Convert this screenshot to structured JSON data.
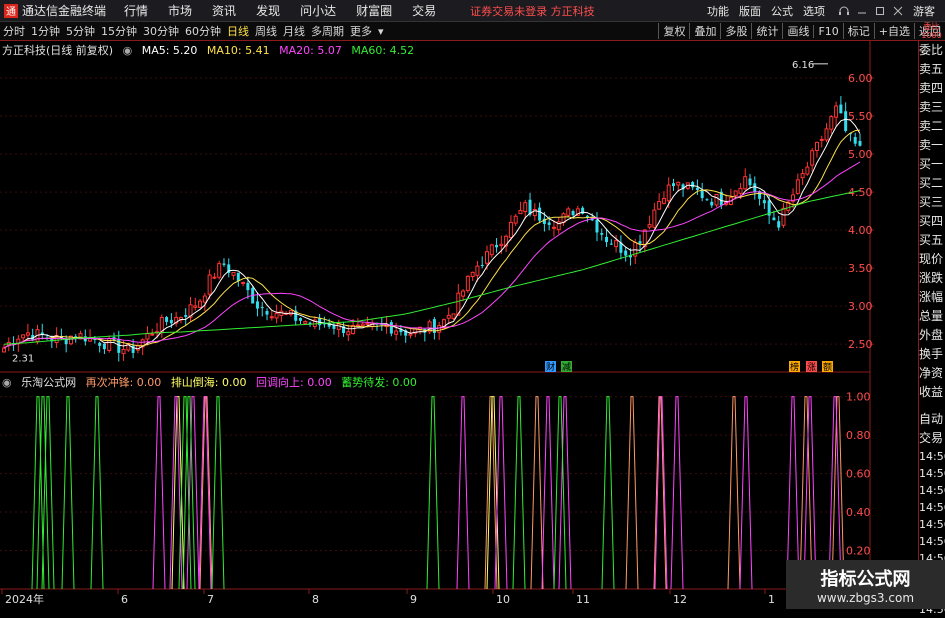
{
  "menubar": {
    "logo_char": "通",
    "app_title": "通达信金融终端",
    "items": [
      "行情",
      "市场",
      "资讯",
      "发现",
      "问小达",
      "财富圈",
      "交易"
    ],
    "notice": "证券交易未登录 方正科技",
    "right_items": [
      "功能",
      "版面",
      "公式",
      "选项"
    ],
    "user": "游客"
  },
  "periods": {
    "items": [
      "分时",
      "1分钟",
      "5分钟",
      "15分钟",
      "30分钟",
      "60分钟",
      "日线",
      "周线",
      "月线",
      "多周期",
      "更多"
    ],
    "active": "日线",
    "tools": [
      "复权",
      "叠加",
      "多股",
      "统计",
      "画线",
      "F10",
      "标记",
      "+自选",
      "返回"
    ]
  },
  "corner": "委比 1000",
  "chart_title": {
    "name": "方正科技(日线 前复权)",
    "ma": [
      {
        "label": "MA5: 5.20",
        "color": "#ffffff"
      },
      {
        "label": "MA10: 5.41",
        "color": "#ffe14a"
      },
      {
        "label": "MA20: 5.07",
        "color": "#ff46ff"
      },
      {
        "label": "MA60: 4.52",
        "color": "#33ee33"
      }
    ]
  },
  "indicator_title": {
    "name": "乐淘公式网",
    "values": [
      {
        "label": "再次冲锋: 0.00",
        "color": "#ff9966"
      },
      {
        "label": "排山倒海: 0.00",
        "color": "#ffff66"
      },
      {
        "label": "回调向上: 0.00",
        "color": "#ff46ff"
      },
      {
        "label": "蓄势待发: 0.00",
        "color": "#33ee33"
      }
    ]
  },
  "annotations": {
    "high_label": "6.16",
    "low_label": "2.31",
    "badges": [
      {
        "text": "财",
        "bg": "#3399ff"
      },
      {
        "text": "减",
        "bg": "#33aa33"
      },
      {
        "text": "榜",
        "bg": "#ffaa00"
      },
      {
        "text": "涨",
        "bg": "#ff4d4d"
      },
      {
        "text": "额",
        "bg": "#ffaa00"
      }
    ]
  },
  "order_book": [
    "委比",
    "卖五",
    "卖四",
    "卖三",
    "卖二",
    "卖一",
    "买一",
    "买二",
    "买三",
    "买四",
    "买五",
    "现价",
    "涨跌",
    "涨幅",
    "总量",
    "外盘",
    "换手",
    "净资",
    "收益"
  ],
  "side_tabs": [
    "自动",
    "交易"
  ],
  "trade_times": [
    "14:56",
    "14:56",
    "14:56",
    "14:56",
    "14:56",
    "14:56",
    "14:56",
    "14:56",
    "14:56",
    "14:56"
  ],
  "watermark": {
    "line1": "指标公式网",
    "line2": "www.zbgs3.com"
  },
  "chart_data": [
    {
      "type": "candlestick",
      "title": "方正科技(日线 前复权)",
      "y_ticks": [
        2.5,
        3.0,
        3.5,
        4.0,
        4.5,
        5.0,
        5.5,
        6.0
      ],
      "ylim": [
        2.2,
        6.25
      ],
      "x_ticks": [
        "2024年",
        "6",
        "7",
        "8",
        "9",
        "10",
        "11",
        "12",
        "1"
      ],
      "high": 6.16,
      "low": 2.31,
      "series": [
        {
          "name": "MA5",
          "value": 5.2
        },
        {
          "name": "MA10",
          "value": 5.41
        },
        {
          "name": "MA20",
          "value": 5.07
        },
        {
          "name": "MA60",
          "value": 4.52
        }
      ],
      "close_path": [
        2.45,
        2.6,
        2.65,
        2.62,
        2.58,
        2.55,
        2.62,
        2.6,
        2.55,
        2.5,
        2.45,
        2.42,
        2.55,
        2.7,
        2.8,
        2.85,
        2.95,
        3.1,
        3.4,
        3.55,
        3.4,
        3.2,
        3.0,
        2.95,
        2.9,
        2.85,
        2.8,
        2.75,
        2.78,
        2.72,
        2.7,
        2.68,
        2.72,
        2.75,
        2.7,
        2.65,
        2.68,
        2.72,
        2.8,
        3.0,
        3.3,
        3.55,
        3.7,
        3.9,
        4.1,
        4.3,
        4.2,
        4.15,
        4.1,
        4.25,
        4.3,
        4.1,
        3.9,
        3.8,
        3.7,
        3.9,
        4.2,
        4.5,
        4.6,
        4.55,
        4.5,
        4.4,
        4.4,
        4.5,
        4.7,
        4.5,
        4.2,
        4.1,
        4.4,
        4.7,
        5.0,
        5.3,
        5.6,
        5.2,
        5.05
      ],
      "ma60_path": [
        2.5,
        2.52,
        2.55,
        2.58,
        2.6,
        2.62,
        2.65,
        2.66,
        2.68,
        2.7,
        2.72,
        2.74,
        2.76,
        2.78,
        2.8,
        2.85,
        2.9,
        2.98,
        3.06,
        3.15,
        3.24,
        3.32,
        3.4,
        3.48,
        3.58,
        3.68,
        3.78,
        3.88,
        3.98,
        4.08,
        4.18,
        4.28,
        4.38,
        4.45,
        4.52
      ]
    },
    {
      "type": "line",
      "title": "乐淘公式网",
      "y_ticks": [
        0.2,
        0.4,
        0.6,
        0.8,
        1.0
      ],
      "ylim": [
        0,
        1.05
      ],
      "series": [
        {
          "name": "再次冲锋",
          "color": "#ff9966",
          "pulses": [
            206,
            491,
            537,
            632,
            660,
            734,
            806,
            838
          ]
        },
        {
          "name": "排山倒海",
          "color": "#ffff66",
          "pulses": [
            178,
            493
          ]
        },
        {
          "name": "回调向上",
          "color": "#ff46ff",
          "pulses": [
            159,
            176,
            193,
            205,
            463,
            501,
            548,
            565,
            661,
            677,
            746,
            793,
            810,
            835
          ]
        },
        {
          "name": "蓄势待发",
          "color": "#33ee33",
          "pulses": [
            38,
            43,
            48,
            68,
            97,
            185,
            189,
            218,
            433,
            519,
            560,
            608
          ]
        }
      ]
    }
  ]
}
